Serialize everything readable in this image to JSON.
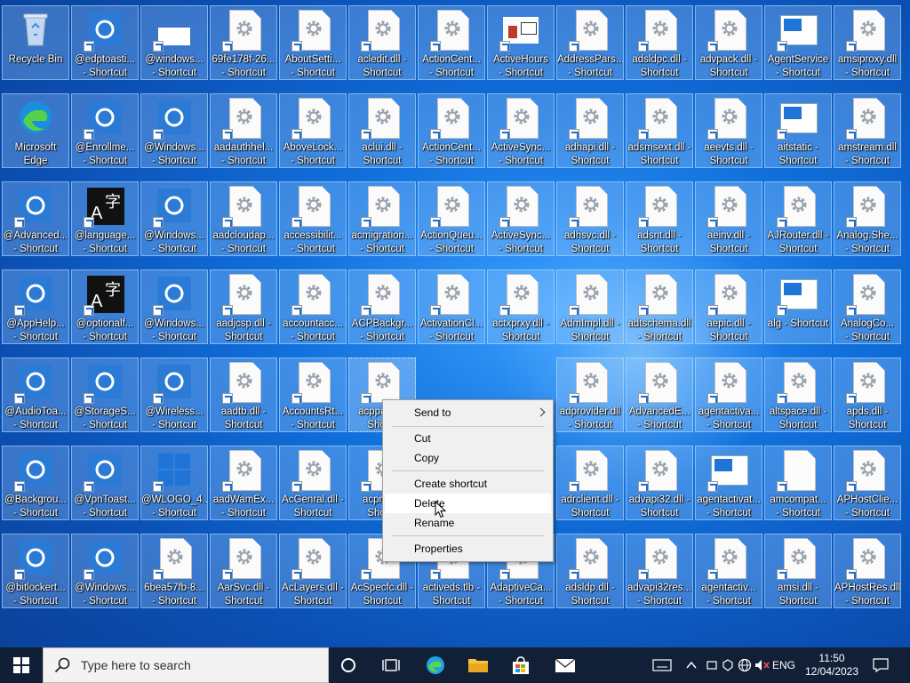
{
  "desktop": {
    "icons": [
      [
        "Recycle Bin",
        "@edptoasti...\n- Shortcut",
        "@windows...\n- Shortcut",
        "69fe178f-26...\n- Shortcut",
        "AboutSetti...\n- Shortcut",
        "acledit.dll -\nShortcut",
        "ActionCent...\n- Shortcut",
        "ActiveHours\n- Shortcut",
        "AddressPars...\n- Shortcut",
        "adsldpc.dll -\nShortcut",
        "advpack.dll -\nShortcut",
        "AgentService\n- Shortcut",
        "amsiproxy.dll\n- Shortcut"
      ],
      [
        "Microsoft\nEdge",
        "@Enrollme...\n- Shortcut",
        "@Windows...\n- Shortcut",
        "aadauthhel...\n- Shortcut",
        "AboveLock...\n- Shortcut",
        "aclui.dll -\nShortcut",
        "ActionCent...\n- Shortcut",
        "ActiveSync...\n- Shortcut",
        "adhapi.dll -\nShortcut",
        "adsmsext.dll -\nShortcut",
        "aeevts.dll -\nShortcut",
        "aitstatic -\nShortcut",
        "amstream.dll\n- Shortcut"
      ],
      [
        "@Advanced...\n- Shortcut",
        "@language...\n- Shortcut",
        "@Windows...\n- Shortcut",
        "aadcloudap...\n- Shortcut",
        "accessibilit...\n- Shortcut",
        "acmigration...\n- Shortcut",
        "ActionQueu...\n- Shortcut",
        "ActiveSync...\n- Shortcut",
        "adhsvc.dll -\nShortcut",
        "adsnt.dll -\nShortcut",
        "aeinv.dll -\nShortcut",
        "AJRouter.dll -\nShortcut",
        "Analog.She...\n- Shortcut"
      ],
      [
        "@AppHelp...\n- Shortcut",
        "@optionalf...\n- Shortcut",
        "@Windows...\n- Shortcut",
        "aadjcsp.dll -\nShortcut",
        "accountacc...\n- Shortcut",
        "ACPBackgr...\n- Shortcut",
        "ActivationCl...\n- Shortcut",
        "actxprxy.dll -\nShortcut",
        "AdmImpl.dll -\nShortcut",
        "adtschema.dll\n- Shortcut",
        "aepic.dll -\nShortcut",
        "alg - Shortcut",
        "AnalogCo...\n- Shortcut"
      ],
      [
        "@AudioToa...\n- Shortcut",
        "@StorageS...\n- Shortcut",
        "@Wireless...\n- Shortcut",
        "aadtb.dll -\nShortcut",
        "AccountsRt...\n- Shortcut",
        "acppage...\nShor...",
        "",
        "",
        "adprovider.dll\n- Shortcut",
        "AdvancedE...\n- Shortcut",
        "agentactiva...\n- Shortcut",
        "altspace.dll -\nShortcut",
        "apds.dll -\nShortcut"
      ],
      [
        "@Backgrou...\n- Shortcut",
        "@VpnToast...\n- Shortcut",
        "@WLOGO_4...\n- Shortcut",
        "aadWamEx...\n- Shortcut",
        "AcGenral.dll -\nShortcut",
        "acprox...\nShor...",
        "",
        "",
        "adrclient.dll -\nShortcut",
        "advapi32.dll -\nShortcut",
        "agentactivat...\n- Shortcut",
        "amcompat...\n- Shortcut",
        "APHostClie...\n- Shortcut"
      ],
      [
        "@bitlockert...\n- Shortcut",
        "@Windows...\n- Shortcut",
        "6bea57fb-8...\n- Shortcut",
        "AarSvc.dll -\nShortcut",
        "AcLayers.dll -\nShortcut",
        "AcSpecfc.dll -\nShortcut",
        "activeds.tlb -\nShortcut",
        "AdaptiveCa...\n- Shortcut",
        "adsldp.dll -\nShortcut",
        "advapi32res...\n- Shortcut",
        "agentactiv...\n- Shortcut",
        "amsi.dll -\nShortcut",
        "APHostRes.dll\n- Shortcut"
      ]
    ]
  },
  "context_menu": {
    "items": {
      "send_to": "Send to",
      "cut": "Cut",
      "copy": "Copy",
      "create_shortcut": "Create shortcut",
      "delete": "Delete",
      "rename": "Rename",
      "properties": "Properties"
    }
  },
  "taskbar": {
    "search_placeholder": "Type here to search",
    "language": "ENG",
    "time": "11:50",
    "date": "12/04/2023"
  },
  "colors": {
    "accent": "#1e74d8",
    "taskbar": "#121e32",
    "menu_bg": "#f0f0f0"
  }
}
